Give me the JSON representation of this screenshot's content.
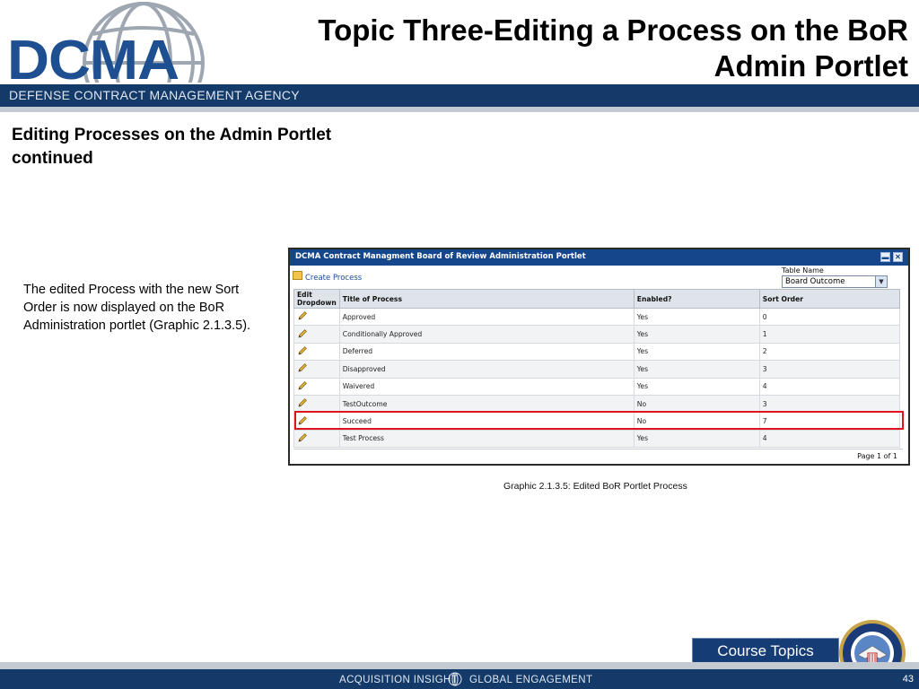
{
  "header": {
    "logo_text": "DCMA",
    "agency_name": "DEFENSE CONTRACT MANAGEMENT AGENCY",
    "title_line1": "Topic Three-Editing a Process on the BoR",
    "title_line2": "Admin Portlet"
  },
  "content": {
    "heading_line1": "Editing Processes on the Admin Portlet",
    "heading_line2": "continued",
    "body_line1": "The edited Process with the new Sort",
    "body_line2": "Order is now displayed on the BoR",
    "body_line3": "Administration portlet (Graphic 2.1.3.5)."
  },
  "portlet": {
    "title": "DCMA Contract Managment Board of Review Administration Portlet",
    "minimize_glyph": "▬",
    "close_glyph": "✕",
    "create_link": "Create Process",
    "table_name_label": "Table Name",
    "table_name_value": "Board Outcome",
    "dropdown_glyph": "▼",
    "columns": {
      "edit": "Edit Dropdown",
      "title": "Title of Process",
      "enabled": "Enabled?",
      "sort": "Sort Order"
    },
    "rows": [
      {
        "title": "Approved",
        "enabled": "Yes",
        "sort": "0"
      },
      {
        "title": "Conditionally Approved",
        "enabled": "Yes",
        "sort": "1"
      },
      {
        "title": "Deferred",
        "enabled": "Yes",
        "sort": "2"
      },
      {
        "title": "Disapproved",
        "enabled": "Yes",
        "sort": "3"
      },
      {
        "title": "Waivered",
        "enabled": "Yes",
        "sort": "4"
      },
      {
        "title": "TestOutcome",
        "enabled": "No",
        "sort": "3"
      },
      {
        "title": "Succeed",
        "enabled": "No",
        "sort": "7"
      },
      {
        "title": "Test Process",
        "enabled": "Yes",
        "sort": "4"
      }
    ],
    "highlighted_row": "Succeed",
    "pager": "Page 1 of 1"
  },
  "caption": "Graphic  2.1.3.5:   Edited BoR Portlet Process",
  "footer": {
    "course_topics": "Course Topics",
    "left_text": "ACQUISITION INSIGHT",
    "right_text": "GLOBAL ENGAGEMENT",
    "page_number": "43"
  },
  "colors": {
    "navy": "#143a6a",
    "logo_blue": "#1d4f91",
    "highlight_red": "#e0141e"
  }
}
